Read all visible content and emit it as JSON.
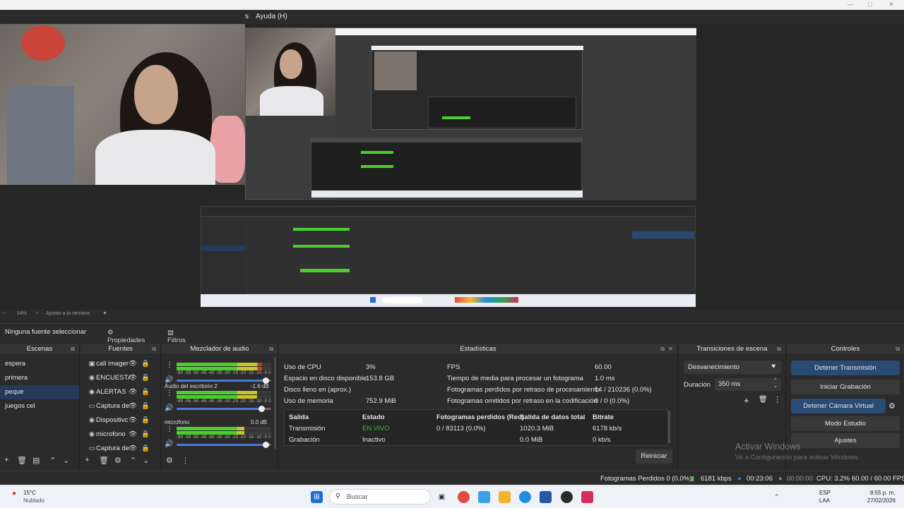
{
  "menu": {
    "help_label": "Ayuda (H)"
  },
  "preview": {
    "zoom": "54%",
    "fit_label": "Ajustar a la ventana"
  },
  "source_bar": {
    "no_source": "Ninguna fuente seleccionar",
    "properties": "Propiedades",
    "filters": "Filtros"
  },
  "scenes": {
    "title": "Escenas",
    "items": [
      {
        "label": "espera",
        "selected": false
      },
      {
        "label": "primera",
        "selected": false
      },
      {
        "label": "peque",
        "selected": true
      },
      {
        "label": "juegos cel",
        "selected": false
      }
    ]
  },
  "sources": {
    "title": "Fuentes",
    "items": [
      {
        "label": "call imager",
        "icon": "image-icon"
      },
      {
        "label": "ENCUESTA",
        "icon": "browser-icon"
      },
      {
        "label": "ALERTAS",
        "icon": "browser-icon"
      },
      {
        "label": "Captura de",
        "icon": "window-capture-icon"
      },
      {
        "label": "Dispositivc",
        "icon": "device-icon"
      },
      {
        "label": "microfono",
        "icon": "microphone-icon"
      },
      {
        "label": "Captura de",
        "icon": "window-capture-icon"
      }
    ]
  },
  "mixer": {
    "title": "Mezclador de audio",
    "ticks": "-60 -55 -50 -45 -40 -35 -30 -25 -20 -15 -10 -5 0",
    "channels": [
      {
        "name": "",
        "db": "",
        "level": 0.9,
        "volume": 0.95
      },
      {
        "name": "Audio del escritorio 2",
        "db": "-1.6 dB",
        "level": 0.85,
        "volume": 0.9
      },
      {
        "name": "microfono",
        "db": "0.0 dB",
        "level": 0.72,
        "volume": 0.95
      }
    ]
  },
  "stats": {
    "title": "Estadísticas",
    "rows_left": [
      {
        "label": "Uso de CPU",
        "value": "3%"
      },
      {
        "label": "Espacio en disco disponible",
        "value": "153.8 GB"
      },
      {
        "label": "Disco lleno en (aprox.)",
        "value": ""
      },
      {
        "label": "Uso de memoria",
        "value": "752.9 MiB"
      }
    ],
    "rows_right": [
      {
        "label": "FPS",
        "value": "60.00"
      },
      {
        "label": "Tiempo de media para procesar un fotograma",
        "value": "1.0 ms"
      },
      {
        "label": "Fotogramas perdidos por retraso de procesamiento",
        "value": "14 / 210236 (0.0%)"
      },
      {
        "label": "Fotogramas omitidos por retraso en la codificación",
        "value": "0 / 0 (0.0%)"
      }
    ],
    "table_headers": [
      "Salida",
      "Estado",
      "Fotogramas perdidos (Red)",
      "Salida de datos total",
      "Bitrate"
    ],
    "table_rows": [
      [
        "Transmisión",
        "EN VIVO",
        "0 / 83113 (0.0%)",
        "1020.3 MiB",
        "6178 kb/s"
      ],
      [
        "Grabación",
        "Inactivo",
        "",
        "0.0 MiB",
        "0 kb/s"
      ]
    ],
    "reset": "Reiniciar"
  },
  "transitions": {
    "title": "Transiciones de escena",
    "selected": "Desvanecimiento",
    "duration_label": "Duración",
    "duration_value": "350 ms"
  },
  "controls": {
    "title": "Controles",
    "buttons": [
      "Detener Transmisión",
      "Iniciar Grabación",
      "Detener Cámara Virtual",
      "Modo Estudio",
      "Ajustes"
    ]
  },
  "watermark": {
    "line1": "Activar Windows",
    "line2": "Ve a Configuración para activar Windows."
  },
  "statusbar": {
    "dropped": "Fotogramas Perdidos 0 (0.0%)",
    "kbps": "6181 kbps",
    "live_time": "00:23:06",
    "rec_time": "00:00:00",
    "cpu": "CPU: 3.2%",
    "fps": "60.00 / 60.00 FPS"
  },
  "taskbar": {
    "weather_temp": "15°C",
    "weather_desc": "Nublado",
    "search": "Buscar",
    "lang1": "ESP",
    "lang2": "LAA",
    "time": "8:55 p. m.",
    "date": "27/02/2026"
  },
  "colors": {
    "live": "#3fbf3f",
    "selection": "#26395a",
    "active_button": "#284a73",
    "meter_green": "#4ccf2e",
    "meter_yellow": "#c9c42a",
    "meter_red": "#c23a2a"
  }
}
